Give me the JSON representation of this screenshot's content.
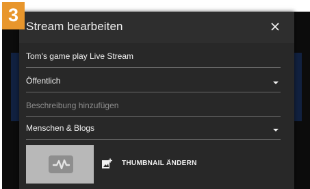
{
  "step_badge": "3",
  "dialog": {
    "title": "Stream bearbeiten",
    "close_icon": "close-icon"
  },
  "fields": {
    "title_value": "Tom's game play Live Stream",
    "visibility_value": "Öffentlich",
    "description_placeholder": "Beschreibung hinzufügen",
    "category_value": "Menschen & Blogs"
  },
  "thumbnail": {
    "preview_icon": "video-waveform-icon",
    "change_icon": "add-image-icon",
    "change_label": "THUMBNAIL ÄNDERN"
  },
  "colors": {
    "accent_badge": "#e8962c",
    "dialog_bg": "#282828",
    "backdrop_panel": "#112140"
  }
}
